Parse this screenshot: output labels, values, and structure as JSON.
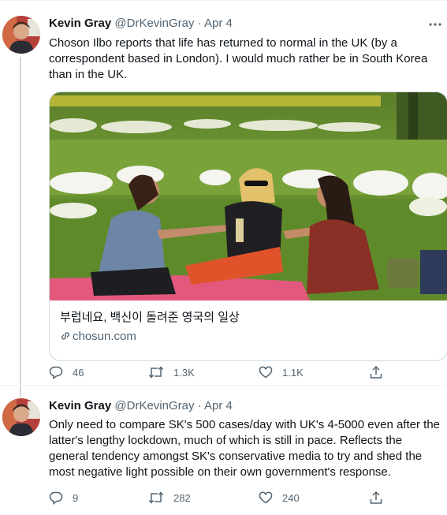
{
  "tweets": [
    {
      "name": "Kevin Gray",
      "handle": "@DrKevinGray",
      "separator": "·",
      "date": "Apr 4",
      "text": "Choson Ilbo reports that life has returned to normal in the UK (by a correspondent based in London). I would much rather be in South Korea than in the UK.",
      "card": {
        "title": "부럽네요, 백신이 돌려준 영국의 일상",
        "domain": "chosun.com"
      },
      "replies": "46",
      "retweets": "1.3K",
      "likes": "1.1K"
    },
    {
      "name": "Kevin Gray",
      "handle": "@DrKevinGray",
      "separator": "·",
      "date": "Apr 4",
      "text": "Only need to compare SK's 500 cases/day with UK's 4-5000 even after the latter's lengthy lockdown, much of which is still in pace. Reflects the general tendency amongst SK's conservative media to try and shed the most negative light possible on their own government's response.",
      "replies": "9",
      "retweets": "282",
      "likes": "240"
    }
  ],
  "icons": {
    "more": "more-horizontal-icon",
    "reply": "reply-icon",
    "retweet": "retweet-icon",
    "like": "heart-icon",
    "share": "share-icon",
    "link": "link-icon"
  },
  "colors": {
    "text": "#0f1419",
    "secondary": "#536471",
    "border": "#cfd9de"
  }
}
